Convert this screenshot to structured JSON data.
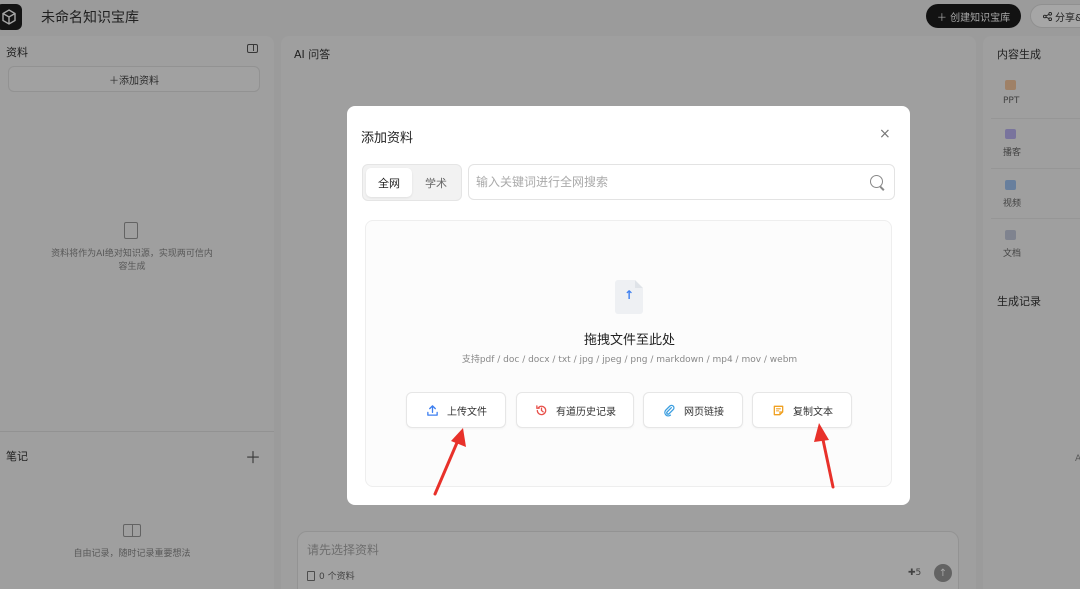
{
  "app": {
    "title": "未命名知识宝库",
    "create_button": "＋ 创建知识宝库",
    "share_button": "分享&"
  },
  "left_panel": {
    "title": "资料",
    "add_button": "＋添加资料",
    "empty_text": "资料将作为AI绝对知识源，实现两可信内容生成",
    "notes_title": "笔记",
    "notes_add": "＋",
    "notes_empty": "自由记录，随时记录重要想法"
  },
  "mid_panel": {
    "title": "AI 问答",
    "input_placeholder": "请先选择资料",
    "material_count": "0 个资料",
    "credits": "✚5",
    "send_icon": "↑"
  },
  "right_panel": {
    "title": "内容生成",
    "items": [
      {
        "label": "PPT",
        "color": "#f5a05a"
      },
      {
        "label": "播客",
        "color": "#8a7cf0"
      },
      {
        "label": "视频",
        "color": "#5b9cf0"
      },
      {
        "label": "文档",
        "color": "#9aa7c8"
      }
    ],
    "history_title": "生成记录",
    "edge_text": "A"
  },
  "modal": {
    "title": "添加资料",
    "close": "×",
    "tabs": [
      "全网",
      "学术"
    ],
    "search_placeholder": "输入关键词进行全网搜索",
    "drop_title": "拖拽文件至此处",
    "drop_formats": "支持pdf / doc / docx / txt / jpg / jpeg / png / markdown / mp4 / mov / webm",
    "actions": [
      {
        "label": "上传文件",
        "icon": "upload-icon",
        "color": "#3d7ff0"
      },
      {
        "label": "有道历史记录",
        "icon": "history-icon",
        "color": "#e8504a"
      },
      {
        "label": "网页链接",
        "icon": "link-icon",
        "color": "#3d9fe0"
      },
      {
        "label": "复制文本",
        "icon": "note-icon",
        "color": "#f0a020"
      }
    ]
  },
  "colors": {
    "annotation_arrow": "#e8312a",
    "accent": "#3d7ff0"
  }
}
